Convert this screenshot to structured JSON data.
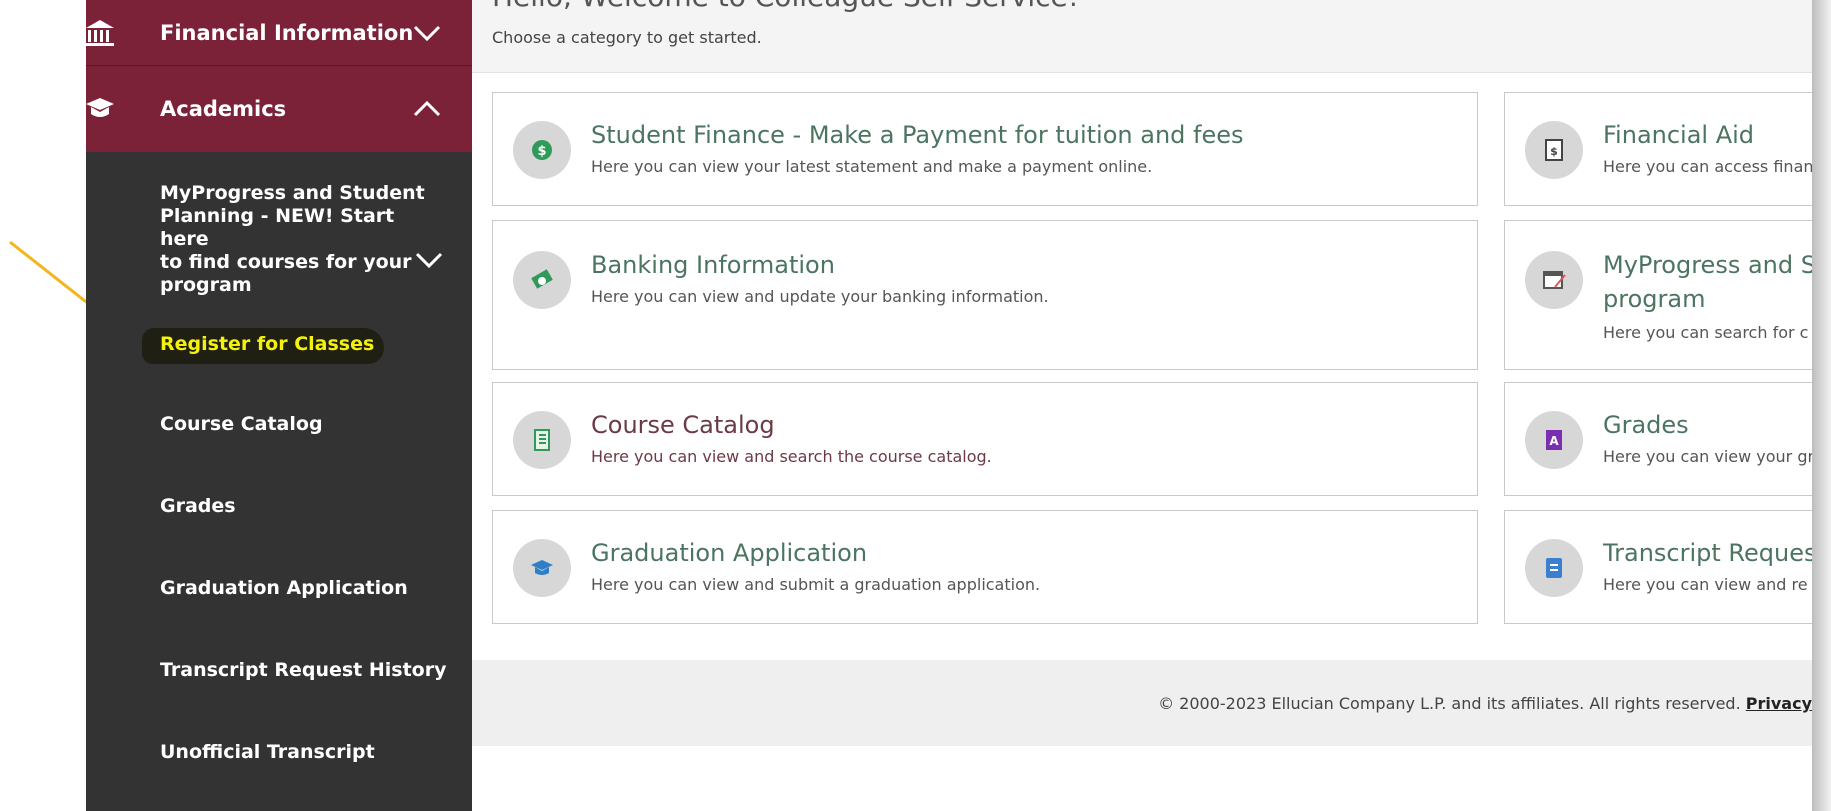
{
  "sidebar": {
    "financial_information": "Financial Information",
    "academics": "Academics",
    "myprogress_lines": [
      "MyProgress and Student",
      "Planning - NEW! Start here",
      "to find courses for your",
      "program"
    ],
    "register": "Register for Classes",
    "course_catalog": "Course Catalog",
    "grades": "Grades",
    "graduation_application": "Graduation Application",
    "transcript_request_history": "Transcript Request History",
    "unofficial_transcript": "Unofficial Transcript"
  },
  "header": {
    "welcome": "Hello, Welcome to Colleague Self-Service!",
    "subtitle": "Choose a category to get started."
  },
  "cards": {
    "student_finance": {
      "title": "Student Finance - Make a Payment for tuition and fees",
      "desc": "Here you can view your latest statement and make a payment online."
    },
    "financial_aid": {
      "title": "Financial Aid",
      "desc": "Here you can access finan"
    },
    "banking": {
      "title": "Banking Information",
      "desc": "Here you can view and update your banking information."
    },
    "myprogress": {
      "title_line1": "MyProgress and St",
      "title_line2": "program",
      "desc": "Here you can search for c"
    },
    "course_catalog": {
      "title": "Course Catalog",
      "desc": "Here you can view and search the course catalog."
    },
    "grades": {
      "title": "Grades",
      "desc": "Here you can view your gr"
    },
    "graduation": {
      "title": "Graduation Application",
      "desc": "Here you can view and submit a graduation application."
    },
    "transcript": {
      "title": "Transcript Request",
      "desc": "Here you can view and re"
    }
  },
  "footer": {
    "copyright": "© 2000-2023 Ellucian Company L.P. and its affiliates. All rights reserved.",
    "privacy": "Privacy"
  },
  "colors": {
    "maroon": "#7b2238",
    "sidebar_dark": "#333333",
    "highlight_yellow": "#f4f20a",
    "arrow": "#f2b51c",
    "title_green": "#4c7560"
  }
}
